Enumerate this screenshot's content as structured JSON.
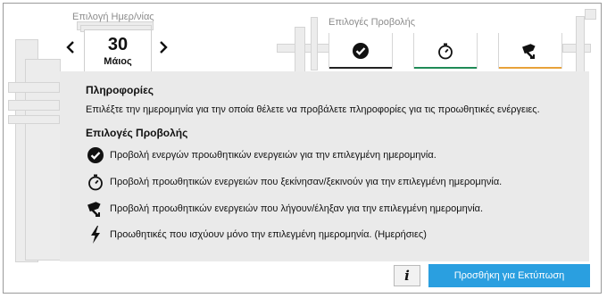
{
  "date_selector": {
    "label": "Επιλογή Ημερ/νίας",
    "day": "30",
    "month": "Μάιος"
  },
  "view_options": {
    "label": "Επιλογές Προβολής",
    "tabs": [
      {
        "icon": "check-circle-icon",
        "accent": "#222222"
      },
      {
        "icon": "stopwatch-icon",
        "accent": "#1f8a56"
      },
      {
        "icon": "flag-arrow-icon",
        "accent": "#e8a23a"
      }
    ]
  },
  "info": {
    "title": "Πληροφορίες",
    "text": "Επιλέξτε την ημερομηνία για την οποία θέλετε να προβάλετε πληροφορίες για τις προωθητικές ενέργειες."
  },
  "options": {
    "title": "Επιλογές Προβολής",
    "items": [
      {
        "icon": "check-circle-icon",
        "text": "Προβολή ενεργών προωθητικών ενεργειών για την επιλεγμένη ημερομηνία."
      },
      {
        "icon": "stopwatch-icon",
        "text": "Προβολή προωθητικών ενεργειών που ξεκίνησαν/ξεκινούν για την επιλεγμένη ημερομηνία."
      },
      {
        "icon": "flag-arrow-icon",
        "text": "Προβολή προωθητικών ενεργειών που λήγουν/έληξαν για την επιλεγμένη ημερομηνία."
      },
      {
        "icon": "lightning-icon",
        "text": "Προωθητικές που ισχύουν μόνο την επιλεγμένη ημερομηνία. (Ημερήσιες)"
      }
    ]
  },
  "buttons": {
    "info_label": "i",
    "print_label": "Προσθήκη για Εκτύπωση"
  },
  "colors": {
    "primary_button": "#2a9fe0",
    "panel_background": "#eaeaea"
  }
}
